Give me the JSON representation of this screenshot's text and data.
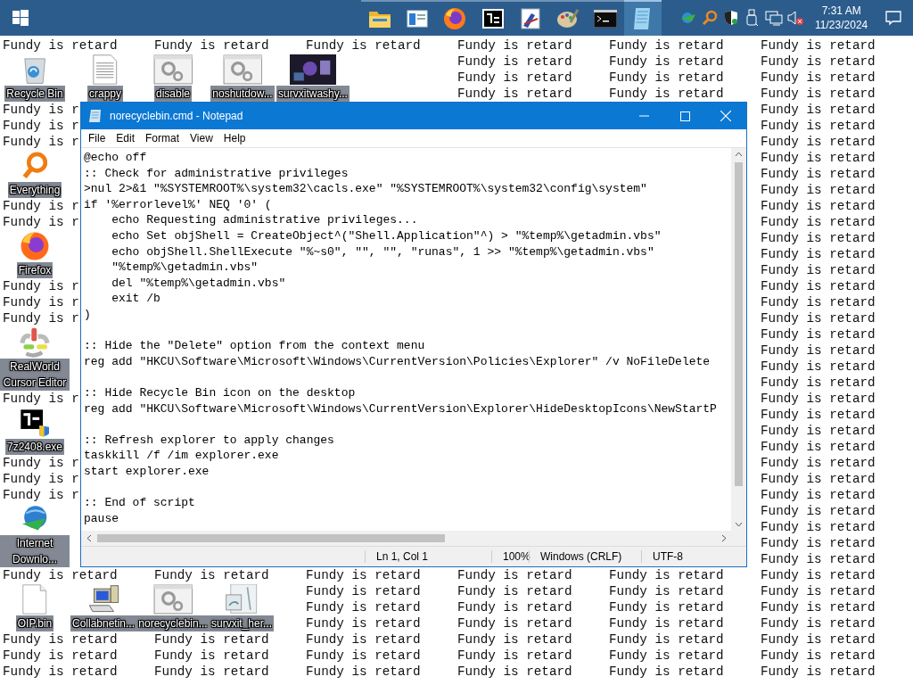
{
  "taskbar": {
    "start": {
      "kind": "windows"
    },
    "apps": [
      {
        "kind": "folder",
        "selected": false
      },
      {
        "kind": "window",
        "selected": false
      },
      {
        "kind": "browser",
        "selected": false
      },
      {
        "kind": "archive",
        "selected": false
      },
      {
        "kind": "paint",
        "selected": false
      },
      {
        "kind": "palette",
        "selected": false
      },
      {
        "kind": "terminal",
        "selected": false
      },
      {
        "kind": "notepad",
        "selected": true
      }
    ],
    "tray": [
      {
        "kind": "globe"
      },
      {
        "kind": "search"
      },
      {
        "kind": "shield"
      },
      {
        "kind": "usb"
      },
      {
        "kind": "network"
      },
      {
        "kind": "speaker-muted"
      }
    ],
    "time": "7:31 AM",
    "date": "11/23/2024"
  },
  "desktop_text": {
    "rows": [
      {
        "cells": [
          "Fundy is retard",
          "Fundy is retard",
          "Fundy is retard",
          "Fundy is retard",
          "Fundy is retard",
          "Fundy is retard"
        ]
      },
      {
        "cells": [
          null,
          null,
          null,
          "Fundy is retard",
          "Fundy is retard",
          "Fundy is retard"
        ]
      },
      {
        "cells": [
          null,
          null,
          null,
          "Fundy is retard",
          "Fundy is retard",
          "Fundy is retard"
        ]
      },
      {
        "cells": [
          null,
          null,
          null,
          "Fundy is retard",
          "Fundy is retard",
          "Fundy is retard"
        ]
      },
      {
        "cells": [
          "Fundy is r",
          null,
          null,
          null,
          null,
          "Fundy is retard"
        ]
      },
      {
        "cells": [
          "Fundy is r",
          null,
          null,
          null,
          null,
          "Fundy is retard"
        ]
      },
      {
        "cells": [
          "Fundy is r",
          null,
          null,
          null,
          null,
          "Fundy is retard"
        ]
      },
      {
        "cells": [
          null,
          null,
          null,
          null,
          null,
          "Fundy is retard"
        ]
      },
      {
        "cells": [
          null,
          null,
          null,
          null,
          null,
          "Fundy is retard"
        ]
      },
      {
        "cells": [
          null,
          null,
          null,
          null,
          null,
          "Fundy is retard"
        ]
      },
      {
        "cells": [
          "Fundy is r",
          null,
          null,
          null,
          null,
          "Fundy is retard"
        ]
      },
      {
        "cells": [
          "Fundy is r",
          null,
          null,
          null,
          null,
          "Fundy is retard"
        ]
      },
      {
        "cells": [
          null,
          null,
          null,
          null,
          null,
          "Fundy is retard"
        ]
      },
      {
        "cells": [
          null,
          null,
          null,
          null,
          null,
          "Fundy is retard"
        ]
      },
      {
        "cells": [
          null,
          null,
          null,
          null,
          null,
          "Fundy is retard"
        ]
      },
      {
        "cells": [
          "Fundy is r",
          null,
          null,
          null,
          null,
          "Fundy is retard"
        ]
      },
      {
        "cells": [
          "Fundy is r",
          null,
          null,
          null,
          null,
          "Fundy is retard"
        ]
      },
      {
        "cells": [
          "Fundy is r",
          null,
          null,
          null,
          null,
          "Fundy is retard"
        ]
      },
      {
        "cells": [
          null,
          null,
          null,
          null,
          null,
          "Fundy is retard"
        ]
      },
      {
        "cells": [
          null,
          null,
          null,
          null,
          null,
          "Fundy is retard"
        ]
      },
      {
        "cells": [
          null,
          null,
          null,
          null,
          null,
          "Fundy is retard"
        ]
      },
      {
        "cells": [
          null,
          null,
          null,
          null,
          null,
          "Fundy is retard"
        ]
      },
      {
        "cells": [
          "Fundy is r",
          null,
          null,
          null,
          null,
          "Fundy is retard"
        ]
      },
      {
        "cells": [
          null,
          null,
          null,
          null,
          null,
          "Fundy is retard"
        ]
      },
      {
        "cells": [
          null,
          null,
          null,
          null,
          null,
          "Fundy is retard"
        ]
      },
      {
        "cells": [
          null,
          null,
          null,
          null,
          null,
          "Fundy is retard"
        ]
      },
      {
        "cells": [
          "Fundy is r",
          null,
          null,
          null,
          null,
          "Fundy is retard"
        ]
      },
      {
        "cells": [
          "Fundy is r",
          null,
          null,
          null,
          null,
          "Fundy is retard"
        ]
      },
      {
        "cells": [
          "Fundy is r",
          null,
          null,
          null,
          null,
          "Fundy is retard"
        ]
      },
      {
        "cells": [
          null,
          null,
          null,
          null,
          null,
          "Fundy is retard"
        ]
      },
      {
        "cells": [
          null,
          null,
          null,
          null,
          null,
          "Fundy is retard"
        ]
      },
      {
        "cells": [
          null,
          null,
          null,
          null,
          null,
          "Fundy is retard"
        ]
      },
      {
        "cells": [
          null,
          null,
          null,
          null,
          null,
          "Fundy is retard"
        ]
      },
      {
        "cells": [
          "Fundy is retard",
          "Fundy is retard",
          "Fundy is retard",
          "Fundy is retard",
          "Fundy is retard",
          "Fundy is retard"
        ]
      },
      {
        "cells": [
          null,
          null,
          "Fundy is retard",
          "Fundy is retard",
          "Fundy is retard",
          "Fundy is retard"
        ]
      },
      {
        "cells": [
          null,
          null,
          "Fundy is retard",
          "Fundy is retard",
          "Fundy is retard",
          "Fundy is retard"
        ]
      },
      {
        "cells": [
          null,
          null,
          "Fundy is retard",
          "Fundy is retard",
          "Fundy is retard",
          "Fundy is retard"
        ]
      },
      {
        "cells": [
          "Fundy is retard",
          "Fundy is retard",
          "Fundy is retard",
          "Fundy is retard",
          "Fundy is retard",
          "Fundy is retard"
        ]
      },
      {
        "cells": [
          "Fundy is retard",
          "Fundy is retard",
          "Fundy is retard",
          "Fundy is retard",
          "Fundy is retard",
          "Fundy is retard"
        ]
      },
      {
        "cells": [
          "Fundy is retard",
          "Fundy is retard",
          "Fundy is retard",
          "Fundy is retard",
          "Fundy is retard",
          "Fundy is retard"
        ]
      }
    ]
  },
  "desktop_icons": [
    {
      "kind": "recycle-bin",
      "label": "Recycle Bin"
    },
    {
      "kind": "document",
      "label": "crappy"
    },
    {
      "kind": "gear-window",
      "label": "disable"
    },
    {
      "kind": "gear-window",
      "label": "noshutdow..."
    },
    {
      "kind": "thumbnail",
      "label": "survxitwashy..."
    },
    {
      "kind": "search-app",
      "label": "Everything"
    },
    {
      "kind": "browser",
      "label": "Firefox"
    },
    {
      "kind": "cursor-tool",
      "label": "RealWorld Cursor Editor"
    },
    {
      "kind": "archive",
      "label": "7z2408.exe"
    },
    {
      "kind": "download-app",
      "label": "Internet Downlo..."
    },
    {
      "kind": "document-blank",
      "label": "OIP.bin"
    },
    {
      "kind": "computer",
      "label": "Collabnetin..."
    },
    {
      "kind": "gear-window",
      "label": "norecyclebin..."
    },
    {
      "kind": "image-file",
      "label": "survxit_her..."
    }
  ],
  "notepad": {
    "title": "norecyclebin.cmd - Notepad",
    "menu": [
      "File",
      "Edit",
      "Format",
      "View",
      "Help"
    ],
    "blocks": [
      [
        "@echo off",
        ":: Check for administrative privileges",
        ">nul 2>&1 \"%SYSTEMROOT%\\system32\\cacls.exe\" \"%SYSTEMROOT%\\system32\\config\\system\"",
        "if '%errorlevel%' NEQ '0' (",
        "    echo Requesting administrative privileges...",
        "    echo Set objShell = CreateObject^(\"Shell.Application\"^) > \"%temp%\\getadmin.vbs\"",
        "    echo objShell.ShellExecute \"%~s0\", \"\", \"\", \"runas\", 1 >> \"%temp%\\getadmin.vbs\"",
        "    \"%temp%\\getadmin.vbs\"",
        "    del \"%temp%\\getadmin.vbs\"",
        "    exit /b",
        ")"
      ],
      [
        ":: Hide the \"Delete\" option from the context menu",
        "reg add \"HKCU\\Software\\Microsoft\\Windows\\CurrentVersion\\Policies\\Explorer\" /v NoFileDelete"
      ],
      [
        ":: Hide Recycle Bin icon on the desktop",
        "reg add \"HKCU\\Software\\Microsoft\\Windows\\CurrentVersion\\Explorer\\HideDesktopIcons\\NewStartP"
      ],
      [
        ":: Refresh explorer to apply changes",
        "taskkill /f /im explorer.exe",
        "start explorer.exe"
      ],
      [
        ":: End of script",
        "pause"
      ]
    ],
    "status": [
      "Ln 1, Col 1",
      "100%",
      "Windows (CRLF)",
      "UTF-8"
    ]
  }
}
